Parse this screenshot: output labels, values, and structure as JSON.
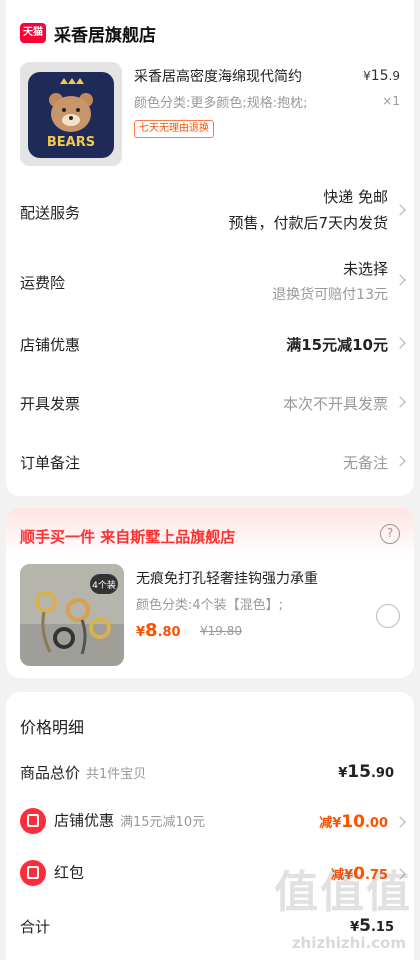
{
  "shop": {
    "badge": "天猫",
    "name": "采香居旗舰店",
    "product": {
      "title": "采香居高密度海绵现代简约",
      "price_symbol": "¥",
      "price_int": "15",
      "price_dec": ".9",
      "spec": "颜色分类:更多颜色;规格:抱枕;",
      "qty": "×1",
      "return_tag": "七天无理由退换",
      "image_text": "BEARS"
    },
    "rows": {
      "delivery_label": "配送服务",
      "delivery_line1": "快递 免邮",
      "delivery_line2": "预售，付款后7天内发货",
      "insurance_label": "运费险",
      "insurance_line1": "未选择",
      "insurance_line2": "退换货可赔付13元",
      "discount_label": "店铺优惠",
      "discount_value": "满15元减10元",
      "invoice_label": "开具发票",
      "invoice_value": "本次不开具发票",
      "note_label": "订单备注",
      "note_value": "无备注"
    }
  },
  "deal": {
    "title": "顺手买一件  来自斯墅上品旗舰店",
    "help_icon": "?",
    "image_badge": "4个装",
    "name": "无痕免打孔轻奢挂钩强力承重",
    "spec": "颜色分类:4个装【混色】;",
    "price_symbol": "¥",
    "price_int": "8",
    "price_dec": ".80",
    "orig_price": "¥19.80"
  },
  "price_detail": {
    "title": "价格明细",
    "total_label": "商品总价",
    "total_sub": "共1件宝贝",
    "total_symbol": "¥",
    "total_int": "15",
    "total_dec": ".90",
    "shop_discount_label": "店铺优惠",
    "shop_discount_sub": "满15元减10元",
    "shop_discount_prefix": "减",
    "shop_discount_symbol": "¥",
    "shop_discount_int": "10",
    "shop_discount_dec": ".00",
    "redpacket_label": "红包",
    "redpacket_prefix": "减",
    "redpacket_symbol": "¥",
    "redpacket_int": "0",
    "redpacket_dec": ".75",
    "sum_label": "合计",
    "sum_symbol": "¥",
    "sum_int": "5",
    "sum_dec": ".15"
  },
  "watermark": {
    "big": "值值值",
    "sub": "zhizhizhi.com"
  },
  "colors": {
    "accent": "#ff5000",
    "tmall": "#ff0036",
    "deal_title": "#ff3030"
  }
}
